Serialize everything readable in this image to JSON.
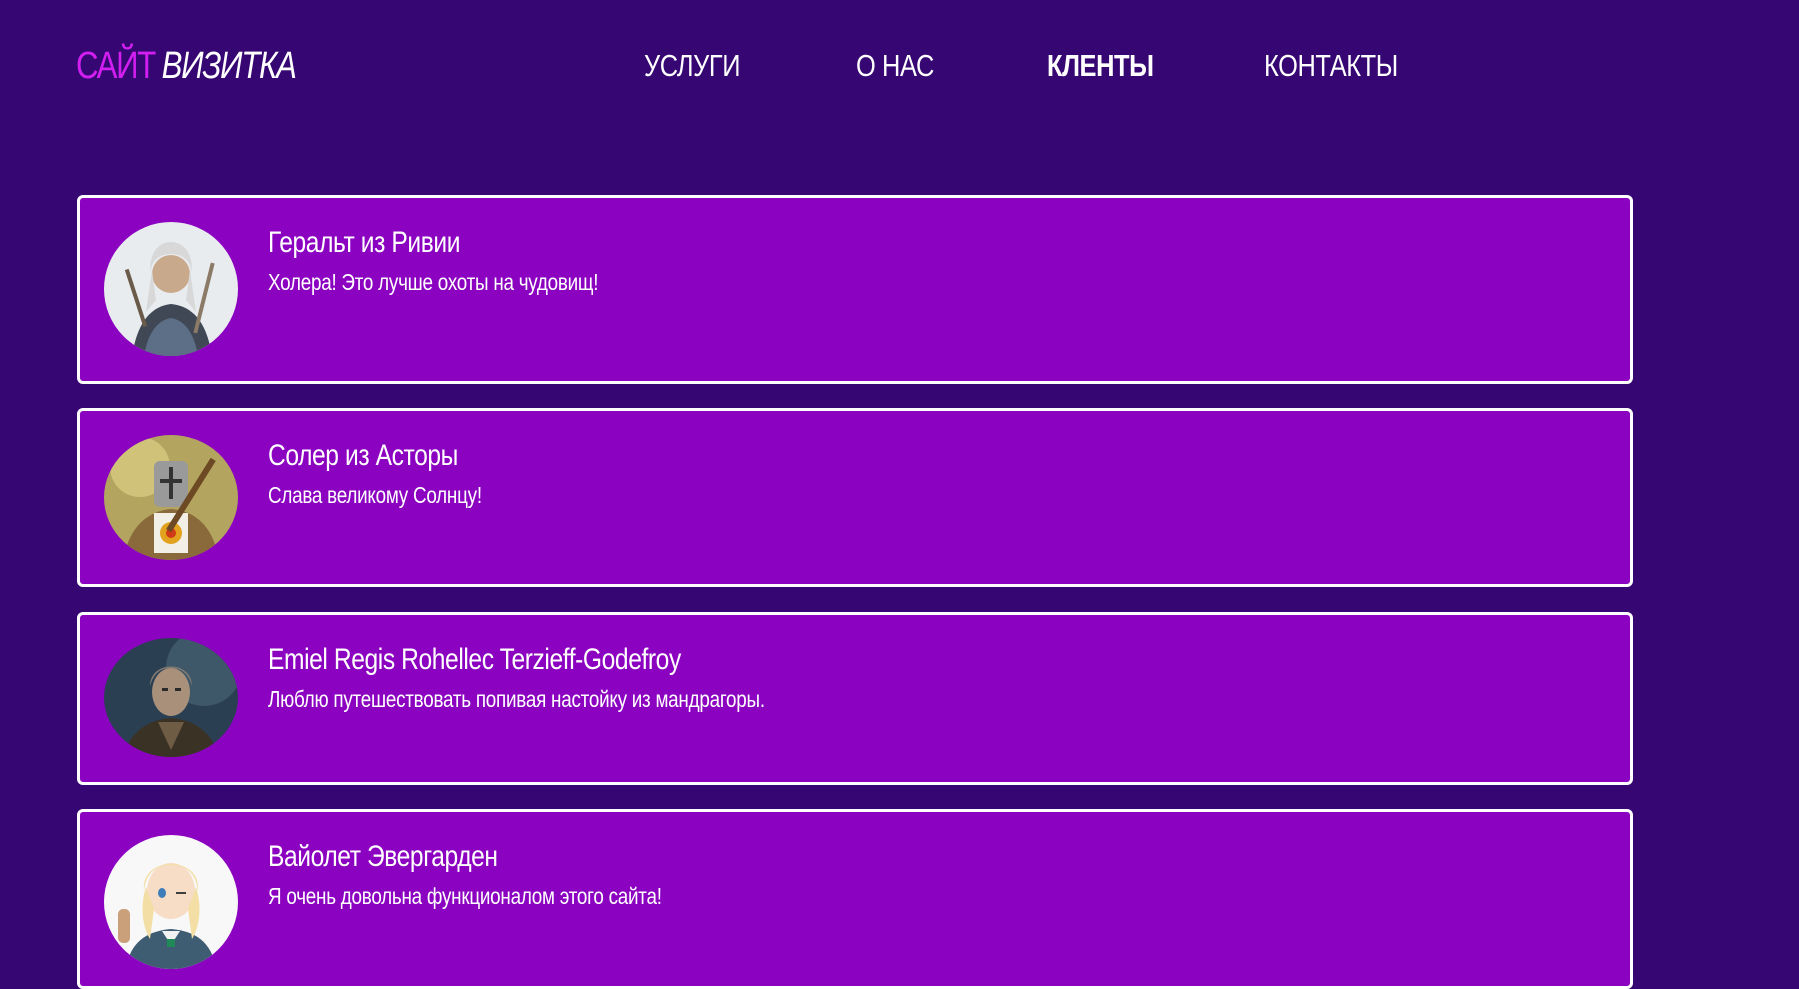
{
  "header": {
    "logo": {
      "part1": "САЙТ",
      "part2": "ВИЗИТКА"
    },
    "nav": [
      {
        "label": "УСЛУГИ"
      },
      {
        "label": "О НАС"
      },
      {
        "label": "КЛЕНТЫ",
        "active": true
      },
      {
        "label": "КОНТАКТЫ"
      }
    ]
  },
  "clients": [
    {
      "name": "Геральт из Ривии",
      "quote": "Холера! Это лучше охоты на чудовищ!",
      "avatar": "geralt-avatar"
    },
    {
      "name": "Солер из Асторы",
      "quote": "Слава великому Солнцу!",
      "avatar": "solaire-avatar"
    },
    {
      "name": "Emiel Regis Rohellec Terzieff-Godefroy",
      "quote": "Люблю путешествовать попивая настойку из мандрагоры.",
      "avatar": "regis-avatar"
    },
    {
      "name": "Вайолет Эвергарден",
      "quote": "Я очень довольна функционалом этого сайта!",
      "avatar": "violet-avatar"
    }
  ],
  "colors": {
    "background": "#360772",
    "card": "#8b02c0",
    "logo_accent": "#d21ef0",
    "text": "#ffffff"
  }
}
